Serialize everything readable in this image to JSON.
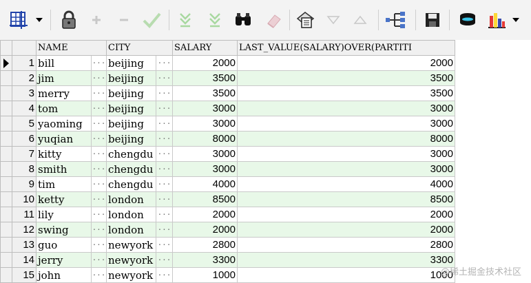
{
  "columns": [
    "NAME",
    "CITY",
    "SALARY",
    "LAST_VALUE(SALARY)OVER(PARTITI"
  ],
  "rows": [
    {
      "n": "1",
      "name": "bill",
      "city": "beijing",
      "salary": "2000",
      "last": "2000"
    },
    {
      "n": "2",
      "name": "jim",
      "city": "beijing",
      "salary": "3500",
      "last": "3500"
    },
    {
      "n": "3",
      "name": "merry",
      "city": "beijing",
      "salary": "3500",
      "last": "3500"
    },
    {
      "n": "4",
      "name": "tom",
      "city": "beijing",
      "salary": "3000",
      "last": "3000"
    },
    {
      "n": "5",
      "name": "yaoming",
      "city": "beijing",
      "salary": "3000",
      "last": "3000"
    },
    {
      "n": "6",
      "name": "yuqian",
      "city": "beijing",
      "salary": "8000",
      "last": "8000"
    },
    {
      "n": "7",
      "name": "kitty",
      "city": "chengdu",
      "salary": "3000",
      "last": "3000"
    },
    {
      "n": "8",
      "name": "smith",
      "city": "chengdu",
      "salary": "3000",
      "last": "3000"
    },
    {
      "n": "9",
      "name": "tim",
      "city": "chengdu",
      "salary": "4000",
      "last": "4000"
    },
    {
      "n": "10",
      "name": "ketty",
      "city": "london",
      "salary": "8500",
      "last": "8500"
    },
    {
      "n": "11",
      "name": "lily",
      "city": "london",
      "salary": "2000",
      "last": "2000"
    },
    {
      "n": "12",
      "name": "swing",
      "city": "london",
      "salary": "2000",
      "last": "2000"
    },
    {
      "n": "13",
      "name": "guo",
      "city": "newyork",
      "salary": "2800",
      "last": "2800"
    },
    {
      "n": "14",
      "name": "jerry",
      "city": "newyork",
      "salary": "3300",
      "last": "3300"
    },
    {
      "n": "15",
      "name": "john",
      "city": "newyork",
      "salary": "1000",
      "last": "1000"
    }
  ],
  "cell_button_glyph": "···",
  "watermark": "@稀土掘金技术社区",
  "colors": {
    "row_alt": "#e8f8e8",
    "grid_line": "#c9c9c9",
    "header_bg": "#f0f0f0"
  },
  "toolbar": {
    "icons": [
      "grid-layout-icon",
      "lock-icon",
      "plus-icon",
      "minus-icon",
      "check-icon",
      "filter-down-icon",
      "filter-clear-icon",
      "binoculars-icon",
      "eraser-icon",
      "query-by-example-icon",
      "triangle-down-icon",
      "triangle-up-icon",
      "tree-view-icon",
      "save-icon",
      "export-icon",
      "chart-icon"
    ]
  }
}
